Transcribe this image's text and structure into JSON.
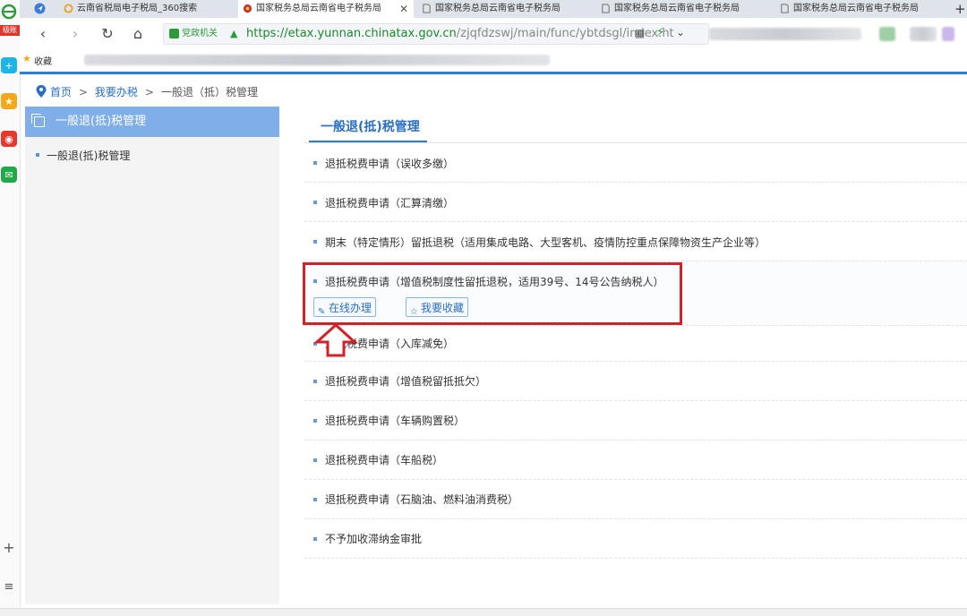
{
  "browser": {
    "rail_badge": "级账号",
    "tabs": [
      {
        "title": "云南省税局电子税局_360搜索",
        "active": false
      },
      {
        "title": "国家税务总局云南省电子税务局",
        "active": true
      },
      {
        "title": "国家税务总局云南省电子税务局",
        "active": false
      },
      {
        "title": "国家税务总局云南省电子税务局",
        "active": false
      },
      {
        "title": "国家税务总局云南省电子税务局",
        "active": false
      }
    ],
    "close_glyph": "✕",
    "new_tab_glyph": "+",
    "gov_badge": "党政机关",
    "url_main": "https://etax.yunnan.chinatax.gov.cn",
    "url_path": "/zjqfdzswj/main/func/ybtdsgl/index.ht",
    "bookmarks_label": "收藏"
  },
  "breadcrumb": {
    "home": "首页",
    "section": "我要办税",
    "current": "一般退（抵）税管理",
    "separator": ">"
  },
  "sidebar": {
    "header": "一般退(抵)税管理",
    "items": [
      {
        "label": "一般退(抵)税管理"
      }
    ]
  },
  "main": {
    "title": "一般退(抵)税管理",
    "items": [
      {
        "label": "退抵税费申请（误收多缴）"
      },
      {
        "label": "退抵税费申请（汇算清缴）"
      },
      {
        "label": "期末（特定情形）留抵退税（适用集成电路、大型客机、疫情防控重点保障物资生产企业等）"
      },
      {
        "label": "退抵税费申请（增值税制度性留抵退税，适用39号、14号公告纳税人）"
      },
      {
        "label": "退抵税费申请（入库减免）"
      },
      {
        "label": "退抵税费申请（增值税留抵抵欠）"
      },
      {
        "label": "退抵税费申请（车辆购置税）"
      },
      {
        "label": "退抵税费申请（车船税）"
      },
      {
        "label": "退抵税费申请（石脑油、燃料油消费税）"
      },
      {
        "label": "不予加收滞纳金审批"
      }
    ],
    "actions": {
      "online": "在线办理",
      "favorite": "我要收藏"
    }
  },
  "colors": {
    "accent": "#2a7fd4",
    "sidebar_header": "#7faee9",
    "highlight": "#d32029"
  }
}
